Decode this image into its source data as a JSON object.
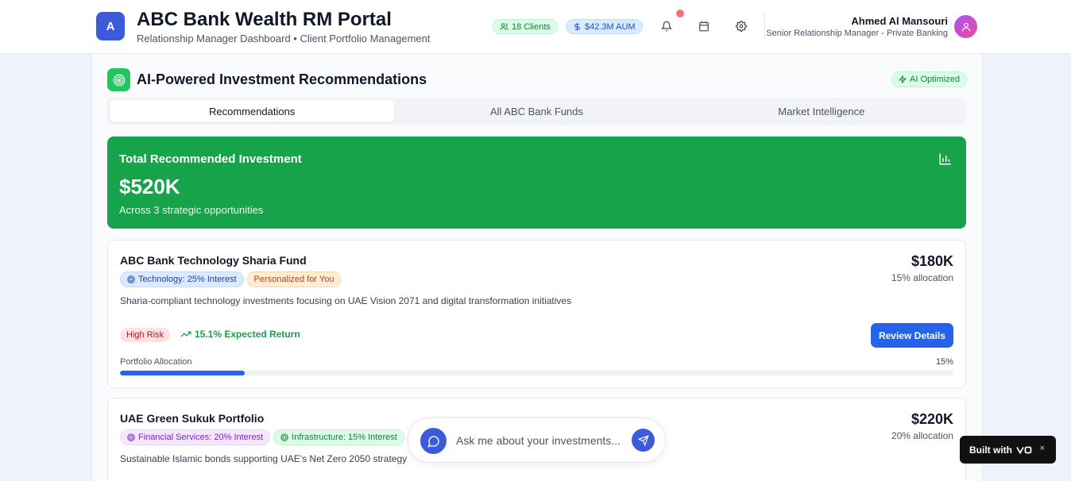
{
  "header": {
    "logo_letter": "A",
    "title": "ABC Bank Wealth RM Portal",
    "subtitle": "Relationship Manager Dashboard • Client Portfolio Management",
    "clients_badge": "18 Clients",
    "aum_badge": "$42.3M AUM",
    "user_name": "Ahmed Al Mansouri",
    "user_role": "Senior Relationship Manager - Private Banking"
  },
  "section": {
    "title": "AI-Powered Investment Recommendations",
    "badge": "AI Optimized"
  },
  "tabs": [
    {
      "label": "Recommendations",
      "active": true
    },
    {
      "label": "All ABC Bank Funds",
      "active": false
    },
    {
      "label": "Market Intelligence",
      "active": false
    }
  ],
  "total": {
    "label": "Total Recommended Investment",
    "value": "$520K",
    "subtitle": "Across 3 strategic opportunities"
  },
  "recommendations": [
    {
      "title": "ABC Bank Technology Sharia Fund",
      "amount": "$180K",
      "allocation": "15% allocation",
      "tags": [
        "Technology: 25% Interest",
        "Personalized for You"
      ],
      "description": "Sharia-compliant technology investments focusing on UAE Vision 2071 and digital transformation initiatives",
      "risk": "High Risk",
      "expected_return": "15.1% Expected Return",
      "review_label": "Review Details",
      "alloc_label": "Portfolio Allocation",
      "alloc_pct": "15%",
      "alloc_value": 0.15
    },
    {
      "title": "UAE Green Sukuk Portfolio",
      "amount": "$220K",
      "allocation": "20% allocation",
      "tags": [
        "Financial Services: 20% Interest",
        "Infrastructure: 15% Interest"
      ],
      "description": "Sustainable Islamic bonds supporting UAE's Net Zero 2050 strategy"
    }
  ],
  "chat": {
    "placeholder": "Ask me about your investments..."
  },
  "built_with": {
    "label": "Built with",
    "close": "×"
  },
  "colors": {
    "primary": "#2563eb",
    "success": "#16a34a",
    "logo": "#3b5bdb"
  }
}
